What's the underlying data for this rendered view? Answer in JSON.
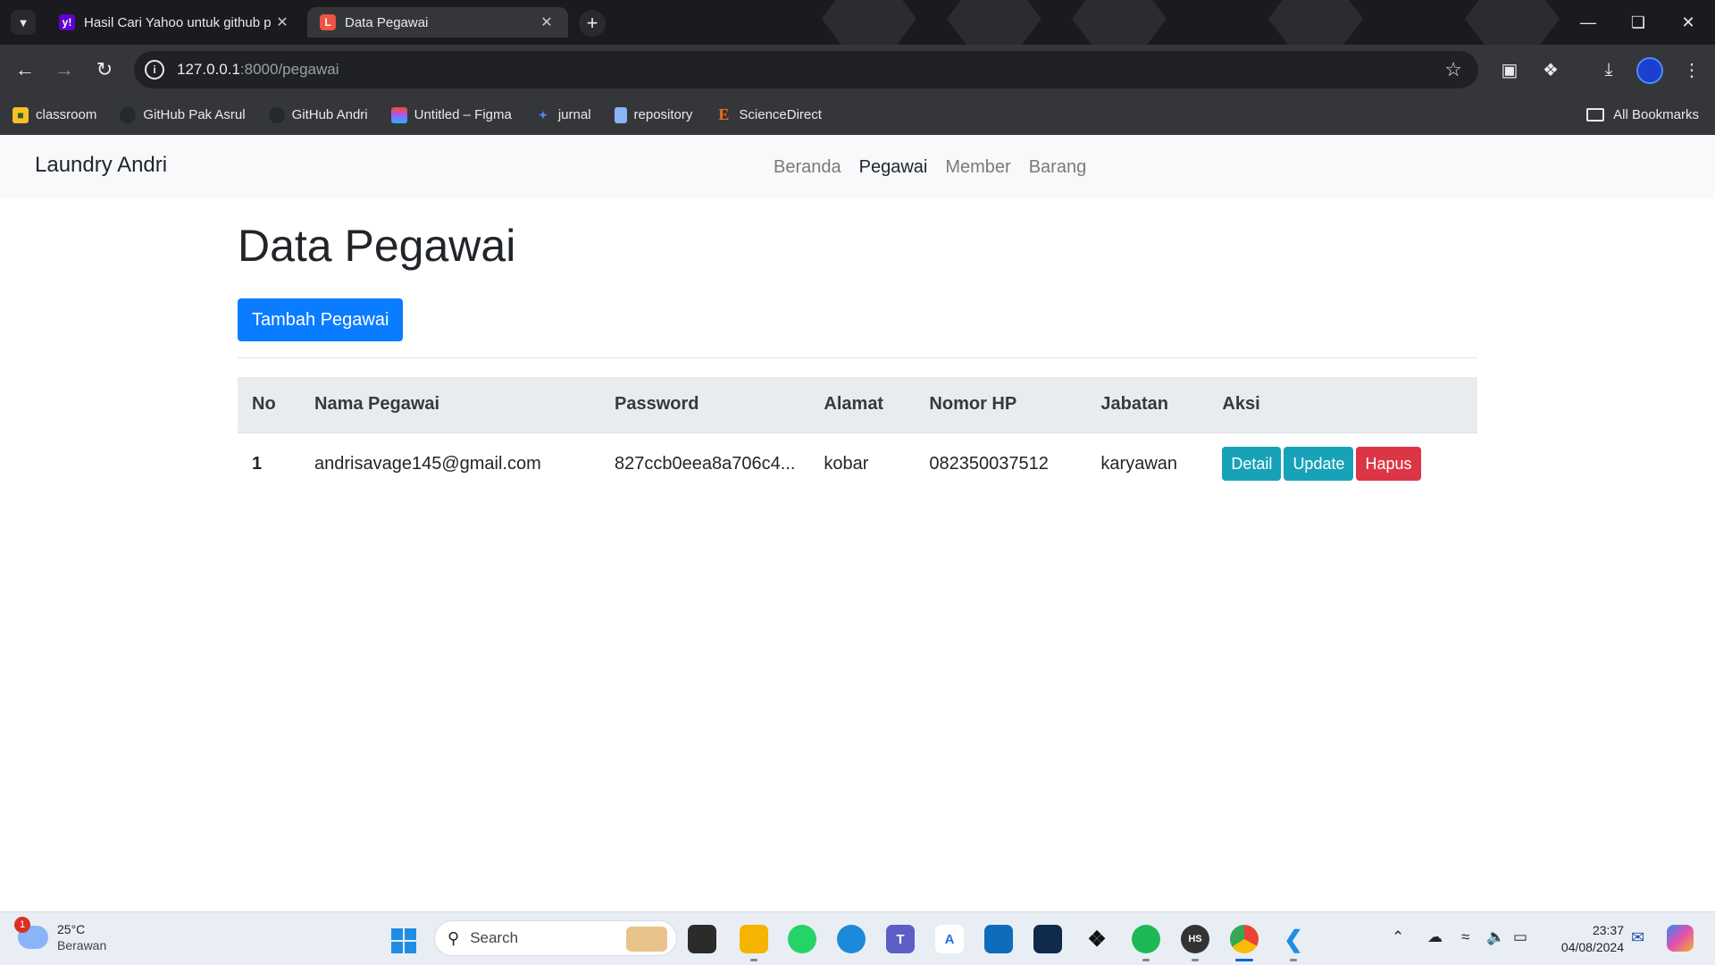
{
  "browser": {
    "tabs": [
      {
        "title": "Hasil Cari Yahoo untuk github p",
        "favicon": "yahoo-icon",
        "active": false
      },
      {
        "title": "Data Pegawai",
        "favicon": "laravel-icon",
        "active": true
      }
    ],
    "url_host": "127.0.0.1",
    "url_path": ":8000/pegawai",
    "bookmarks": [
      {
        "label": "classroom",
        "icon": "classroom-icon"
      },
      {
        "label": "GitHub Pak Asrul",
        "icon": "github-icon"
      },
      {
        "label": "GitHub Andri",
        "icon": "github-icon"
      },
      {
        "label": "Untitled – Figma",
        "icon": "figma-icon"
      },
      {
        "label": "jurnal",
        "icon": "jurnal-icon"
      },
      {
        "label": "repository",
        "icon": "file-icon"
      },
      {
        "label": "ScienceDirect",
        "icon": "sciencedirect-icon"
      }
    ],
    "all_bookmarks_label": "All Bookmarks"
  },
  "site": {
    "brand": "Laundry Andri",
    "nav": [
      {
        "label": "Beranda",
        "active": false
      },
      {
        "label": "Pegawai",
        "active": true
      },
      {
        "label": "Member",
        "active": false
      },
      {
        "label": "Barang",
        "active": false
      }
    ]
  },
  "main": {
    "title": "Data Pegawai",
    "add_button": "Tambah Pegawai",
    "table": {
      "headers": [
        "No",
        "Nama Pegawai",
        "Password",
        "Alamat",
        "Nomor HP",
        "Jabatan",
        "Aksi"
      ],
      "rows": [
        {
          "no": "1",
          "nama": "andrisavage145@gmail.com",
          "password": "827ccb0eea8a706c4...",
          "alamat": "kobar",
          "nomor_hp": "082350037512",
          "jabatan": "karyawan"
        }
      ],
      "actions": {
        "detail": "Detail",
        "update": "Update",
        "hapus": "Hapus"
      }
    }
  },
  "taskbar": {
    "weather_badge": "1",
    "temperature": "25°C",
    "condition": "Berawan",
    "search_placeholder": "Search",
    "time": "23:37",
    "date": "04/08/2024"
  },
  "colors": {
    "primary": "#0a7cff",
    "info": "#17a2b8",
    "danger": "#dc3545",
    "navbar_bg": "#f8f9fa",
    "chrome_bg": "#35363a"
  }
}
